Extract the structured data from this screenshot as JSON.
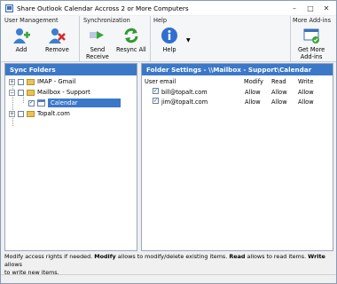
{
  "window": {
    "title": "Share Outlook Calendar Accross 2 or More Computers"
  },
  "ribbon": {
    "groups": {
      "user_management": "User Management",
      "synchronization": "Synchronization",
      "help": "Help",
      "more_addins": "More Add-ins"
    },
    "buttons": {
      "add": "Add",
      "remove": "Remove",
      "send_receive_1": "Send",
      "send_receive_2": "Receive",
      "resync_all": "Resync All",
      "help": "Help",
      "get_more_1": "Get More",
      "get_more_2": "Add-ins"
    }
  },
  "sync_folders": {
    "header": "Sync Folders",
    "items": [
      {
        "label": "IMAP - Gmail",
        "checked": false
      },
      {
        "label": "Mailbox - Support",
        "checked": false
      },
      {
        "label": "Calendar",
        "checked": true,
        "selected": true
      },
      {
        "label": "Topalt.com",
        "checked": false
      }
    ]
  },
  "folder_settings": {
    "header": "Folder Settings - \\\\Mailbox - Support\\Calendar",
    "columns": {
      "email": "User email",
      "modify": "Modify",
      "read": "Read",
      "write": "Write"
    },
    "rows": [
      {
        "email": "bill@topalt.com",
        "modify": "Allow",
        "read": "Allow",
        "write": "Allow",
        "checked": true
      },
      {
        "email": "jim@topalt.com",
        "modify": "Allow",
        "read": "Allow",
        "write": "Allow",
        "checked": true
      }
    ]
  },
  "status": {
    "t1": "Modify access rights if needed. ",
    "b1": "Modify",
    "t2": " allows to modify/delete existing items. ",
    "b2": "Read",
    "t3": " allows to read items. ",
    "b3": "Write",
    "t4": " allows",
    "t5": "to write new items."
  },
  "colors": {
    "panel_header": "#3c78c8",
    "selection": "#3c78c8"
  }
}
